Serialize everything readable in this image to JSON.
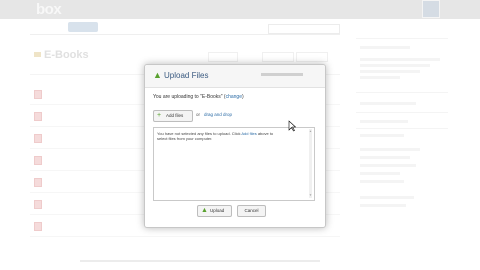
{
  "app": {
    "logo": "box",
    "tagline": "",
    "user_name": "",
    "user_sub": ""
  },
  "nav": {
    "tabs": [
      "",
      "",
      "",
      "",
      ""
    ]
  },
  "folder": {
    "title": "E-Books",
    "breadcrumb": ""
  },
  "files": [
    {
      "name": "",
      "meta": ""
    },
    {
      "name": "",
      "meta": ""
    },
    {
      "name": "",
      "meta": ""
    },
    {
      "name": "",
      "meta": ""
    },
    {
      "name": "",
      "meta": ""
    },
    {
      "name": "",
      "meta": ""
    },
    {
      "name": "",
      "meta": ""
    }
  ],
  "dialog": {
    "title": "Upload Files",
    "destination_prefix": "You are uploading to \"E-Books\" (",
    "change_link": "change",
    "destination_suffix": ")",
    "add_files_label": "Add files",
    "or_text": "or",
    "drag_drop_link": "drag and drop",
    "drop_message_1": "You have not selected any files to upload. Click ",
    "drop_message_link": "Add files",
    "drop_message_2": " above to select files from your computer.",
    "upload_label": "Upload",
    "cancel_label": "Cancel"
  },
  "colors": {
    "accent": "#2c6ca6",
    "upload_green": "#59a12f",
    "title_blue": "#3a5a80"
  },
  "icons": {
    "upload": "green-up-arrow",
    "add_files": "green-plus"
  }
}
